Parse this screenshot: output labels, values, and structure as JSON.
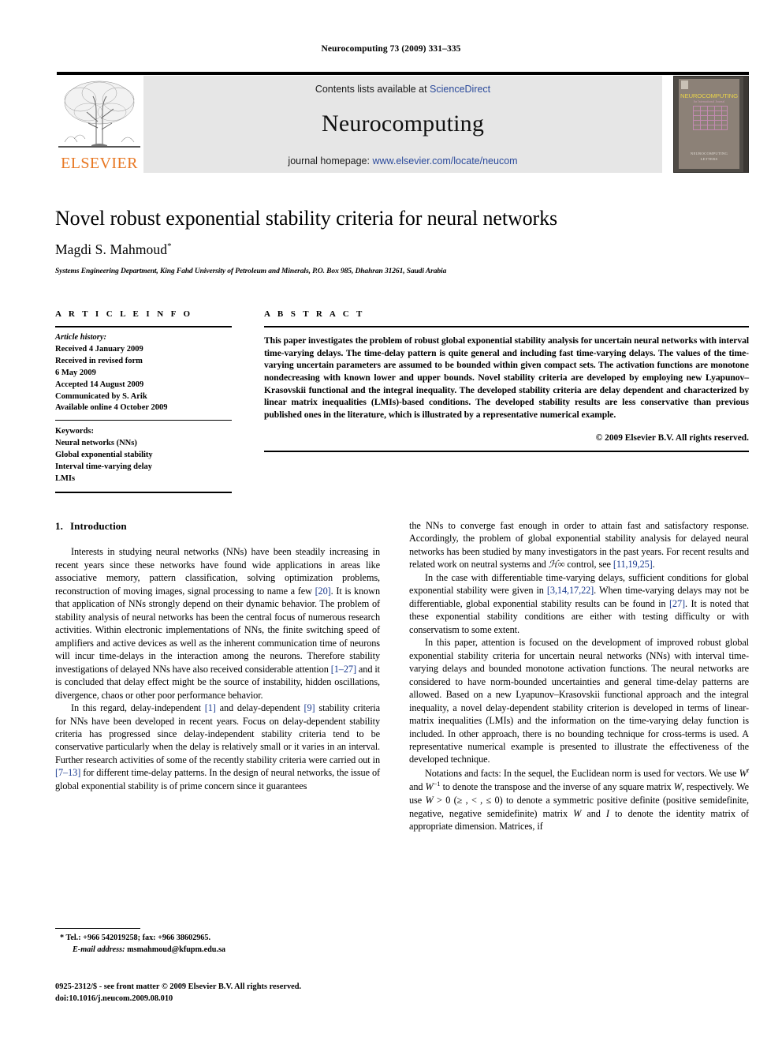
{
  "running_head": "Neurocomputing 73 (2009) 331–335",
  "masthead": {
    "contents_prefix": "Contents lists available at ",
    "contents_link": "ScienceDirect",
    "journal_title": "Neurocomputing",
    "homepage_prefix": "journal homepage: ",
    "homepage_url": "www.elsevier.com/locate/neucom",
    "publisher_logo_text": "ELSEVIER",
    "cover": {
      "journal_name": "NEUROCOMPUTING",
      "subtitle": "An International Journal",
      "footer_line1": "NEUROCOMPUTING",
      "footer_line2": "LETTERS"
    }
  },
  "title_block": {
    "title": "Novel robust exponential stability criteria for neural networks",
    "author": "Magdi S. Mahmoud",
    "author_marker": "*",
    "affiliation": "Systems Engineering Department, King Fahd University of Petroleum and Minerals, P.O. Box 985, Dhahran 31261, Saudi Arabia"
  },
  "article_info": {
    "heading": "A R T I C L E   I N F O",
    "history_label": "Article history:",
    "history": [
      "Received 4 January 2009",
      "Received in revised form",
      "6 May 2009",
      "Accepted 14 August 2009",
      "Communicated by S. Arik",
      "Available online 4 October 2009"
    ],
    "keywords_label": "Keywords:",
    "keywords": [
      "Neural networks (NNs)",
      "Global exponential stability",
      "Interval time-varying delay",
      "LMIs"
    ]
  },
  "abstract": {
    "heading": "A B S T R A C T",
    "text": "This paper investigates the problem of robust global exponential stability analysis for uncertain neural networks with interval time-varying delays. The time-delay pattern is quite general and including fast time-varying delays. The values of the time-varying uncertain parameters are assumed to be bounded within given compact sets. The activation functions are monotone nondecreasing with known lower and upper bounds. Novel stability criteria are developed by employing new Lyapunov–Krasovskii functional and the integral inequality. The developed stability criteria are delay dependent and characterized by linear matrix inequalities (LMIs)-based conditions. The developed stability results are less conservative than previous published ones in the literature, which is illustrated by a representative numerical example.",
    "copyright": "© 2009 Elsevier B.V. All rights reserved."
  },
  "body": {
    "section_number": "1.",
    "section_title": "Introduction",
    "left_paragraphs": [
      {
        "segments": [
          {
            "t": "Interests in studying neural networks (NNs) have been steadily increasing in recent years since these networks have found wide applications in areas like associative memory, pattern classification, solving optimization problems, reconstruction of moving images, signal processing to name a few "
          },
          {
            "t": "[20]",
            "k": "ref"
          },
          {
            "t": ". It is known that application of NNs strongly depend on their dynamic behavior. The problem of stability analysis of neural networks has been the central focus of numerous research activities. Within electronic implementations of NNs, the finite switching speed of amplifiers and active devices as well as the inherent communication time of neurons will incur time-delays in the interaction among the neurons. Therefore stability investigations of delayed NNs have also received considerable attention "
          },
          {
            "t": "[1–27]",
            "k": "ref"
          },
          {
            "t": " and it is concluded that delay effect might be the source of instability, hidden oscillations, divergence, chaos or other poor performance behavior."
          }
        ]
      },
      {
        "segments": [
          {
            "t": "In this regard, delay-independent "
          },
          {
            "t": "[1]",
            "k": "ref"
          },
          {
            "t": " and delay-dependent "
          },
          {
            "t": "[9]",
            "k": "ref"
          },
          {
            "t": " stability criteria for NNs have been developed in recent years. Focus on delay-dependent stability criteria has progressed since delay-independent stability criteria tend to be conservative particularly when the delay is relatively small or it varies in an interval. Further research activities of some of the recently stability criteria were carried out in "
          },
          {
            "t": "[7–13]",
            "k": "ref"
          },
          {
            "t": " for different time-delay patterns. In the design of neural networks, the issue of global exponential stability is of prime concern since it guarantees"
          }
        ]
      }
    ],
    "right_paragraphs": [
      {
        "continuation": true,
        "segments": [
          {
            "t": "the NNs to converge fast enough in order to attain fast and satisfactory response. Accordingly, the problem of global exponential stability analysis for delayed neural networks has been studied by many investigators in the past years. For recent results and related work on neutral systems and "
          },
          {
            "t": "ℋ∞",
            "k": "cal"
          },
          {
            "t": " control, see "
          },
          {
            "t": "[11,19,25]",
            "k": "ref"
          },
          {
            "t": "."
          }
        ]
      },
      {
        "segments": [
          {
            "t": "In the case with differentiable time-varying delays, sufficient conditions for global exponential stability were given in "
          },
          {
            "t": "[3,14,17,22]",
            "k": "ref"
          },
          {
            "t": ". When time-varying delays may not be differentiable, global exponential stability results can be found in "
          },
          {
            "t": "[27]",
            "k": "ref"
          },
          {
            "t": ". It is noted that these exponential stability conditions are either with testing difficulty or with conservatism to some extent."
          }
        ]
      },
      {
        "segments": [
          {
            "t": "In this paper, attention is focused on the development of improved robust global exponential stability criteria for uncertain neural networks (NNs) with interval time-varying delays and bounded monotone activation functions. The neural networks are considered to have norm-bounded uncertainties and general time-delay patterns are allowed. Based on a new Lyapunov–Krasovskii functional approach and the integral inequality, a novel delay-dependent stability criterion is developed in terms of linear-matrix inequalities (LMIs) and the information on the time-varying delay function is included. In other approach, there is no bounding technique for cross-terms is used. A representative numerical example is presented to illustrate the effectiveness of the developed technique."
          }
        ]
      },
      {
        "segments": [
          {
            "t": "Notations and facts: In the sequel, the Euclidean norm is used for vectors. We use "
          },
          {
            "t": "W",
            "k": "mathit"
          },
          {
            "t": "t",
            "k": "sup-it"
          },
          {
            "t": " and "
          },
          {
            "t": "W",
            "k": "mathit"
          },
          {
            "t": "−1",
            "k": "sup"
          },
          {
            "t": " to denote the transpose and the inverse of any square matrix "
          },
          {
            "t": "W",
            "k": "mathit"
          },
          {
            "t": ", respectively. We use "
          },
          {
            "t": "W",
            "k": "mathit"
          },
          {
            "t": " > 0 ("
          },
          {
            "t": "≥ , < , ≤ 0"
          },
          {
            "t": ") to denote a symmetric positive definite (positive semidefinite, negative, negative semidefinite) matrix "
          },
          {
            "t": "W",
            "k": "mathit"
          },
          {
            "t": " and "
          },
          {
            "t": "I",
            "k": "mathit"
          },
          {
            "t": " to denote the identity matrix of appropriate dimension. Matrices, if"
          }
        ]
      }
    ]
  },
  "footnote": {
    "marker": "*",
    "tel_fax": "Tel.: +966 542019258; fax: +966 38602965.",
    "email_label": "E-mail address:",
    "email": "msmahmoud@kfupm.edu.sa"
  },
  "imprint": {
    "line1": "0925-2312/$ - see front matter © 2009 Elsevier B.V. All rights reserved.",
    "line2": "doi:10.1016/j.neucom.2009.08.010"
  },
  "colors": {
    "link": "#2b4a9b",
    "reference": "#1a3a8f",
    "elsevier_orange": "#e87722",
    "masthead_bg": "#e6e6e6"
  }
}
